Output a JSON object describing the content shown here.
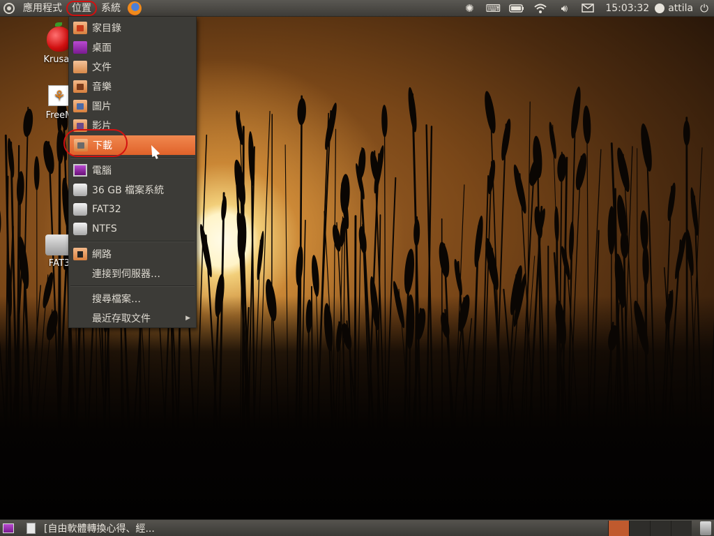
{
  "top_panel": {
    "menus": [
      "應用程式",
      "位置",
      "系統"
    ],
    "active_menu": "位置",
    "clock": "15:03:32",
    "user": "attila"
  },
  "desktop": {
    "icons": [
      {
        "label": "Krusad",
        "icon": "apple-icon"
      },
      {
        "label": "FreeM",
        "icon": "butterfly-icon"
      },
      {
        "label": "FAT3",
        "icon": "drive-icon"
      }
    ]
  },
  "places_menu": {
    "items": [
      {
        "label": "家目錄",
        "icon": "home-folder-icon"
      },
      {
        "label": "桌面",
        "icon": "desktop-folder-icon"
      },
      {
        "label": "文件",
        "icon": "documents-folder-icon"
      },
      {
        "label": "音樂",
        "icon": "music-folder-icon"
      },
      {
        "label": "圖片",
        "icon": "pictures-folder-icon"
      },
      {
        "label": "影片",
        "icon": "videos-folder-icon"
      },
      {
        "label": "下載",
        "icon": "downloads-folder-icon",
        "highlighted": true
      },
      {
        "label": "電腦",
        "icon": "computer-icon"
      },
      {
        "label": "36 GB 檔案系統",
        "icon": "harddisk-icon"
      },
      {
        "label": "FAT32",
        "icon": "harddisk-icon"
      },
      {
        "label": "NTFS",
        "icon": "harddisk-icon"
      },
      {
        "label": "網路",
        "icon": "network-icon"
      },
      {
        "label": "連接到伺服器…"
      },
      {
        "label": "搜尋檔案…"
      },
      {
        "label": "最近存取文件",
        "submenu": true
      }
    ]
  },
  "bottom_panel": {
    "task": "[自由軟體轉換心得、經..."
  },
  "colors": {
    "highlight": "#e8703a",
    "annotation": "#d31010",
    "panel": "#3c3b37"
  }
}
